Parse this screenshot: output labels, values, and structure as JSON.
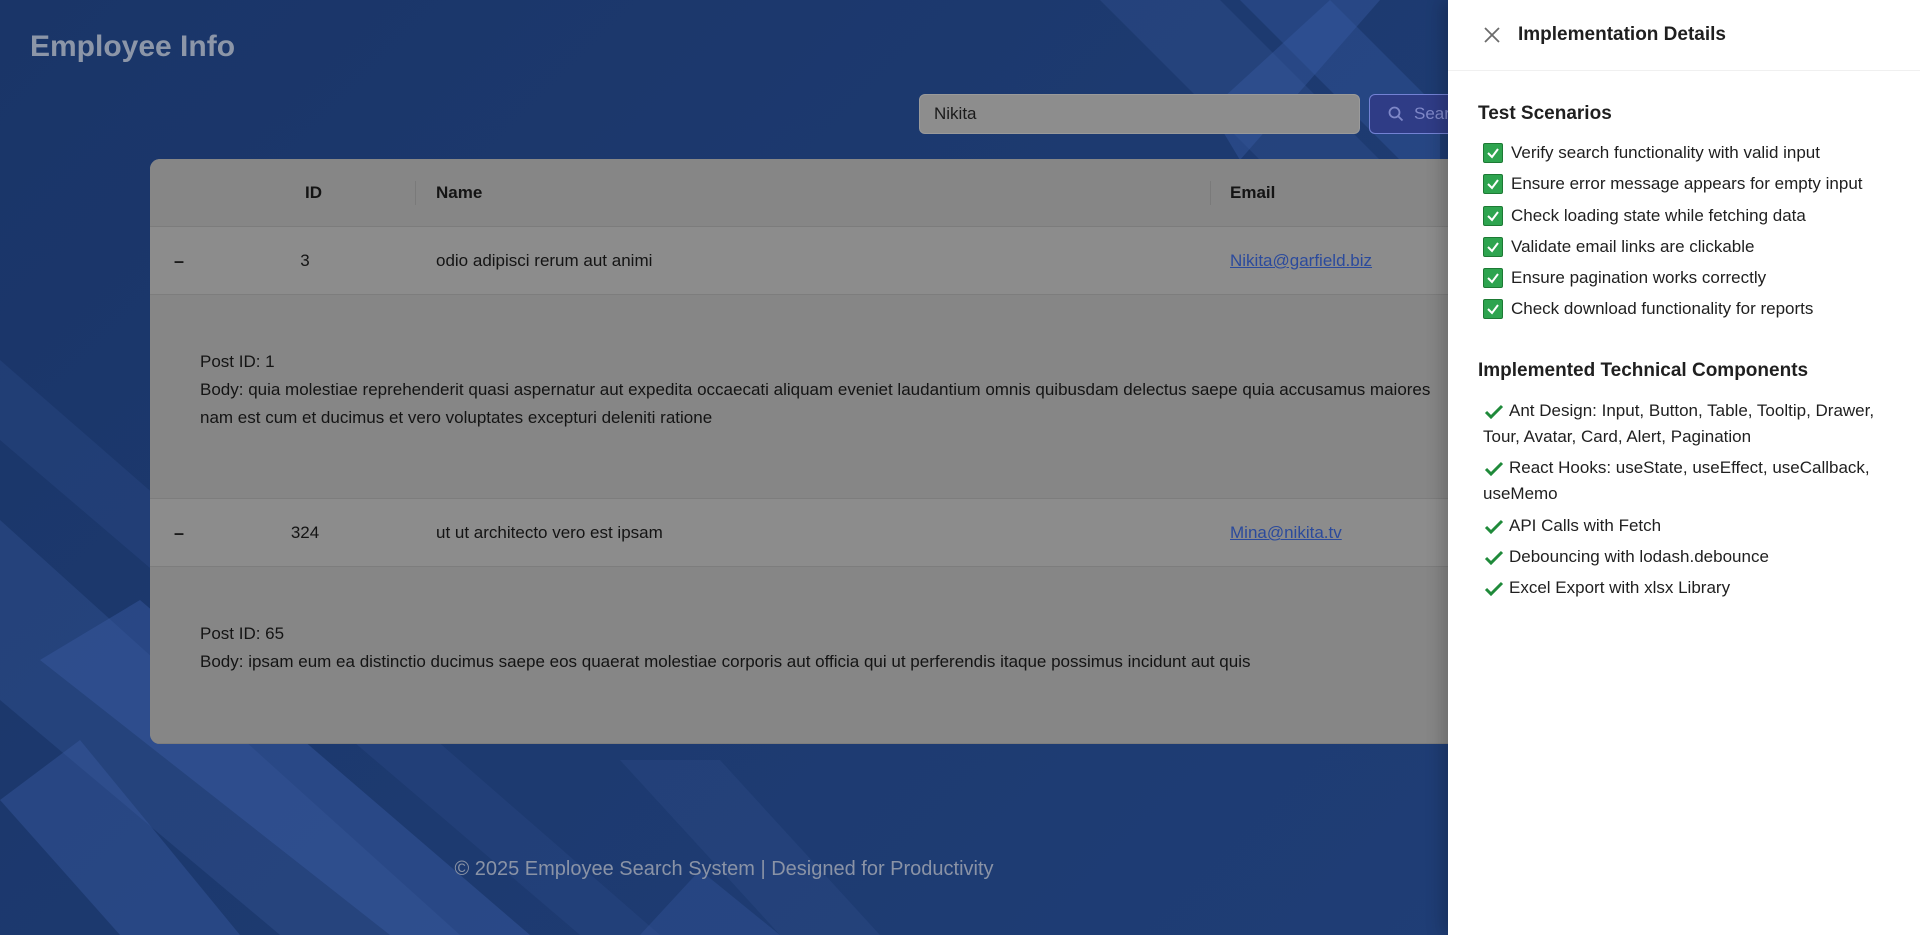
{
  "app": {
    "title": "Employee Info"
  },
  "search": {
    "value": "Nikita",
    "button_label": "Search"
  },
  "table": {
    "columns": {
      "id": "ID",
      "name": "Name",
      "email": "Email"
    },
    "rows": [
      {
        "id": "3",
        "name": "odio adipisci rerum aut animi",
        "email": "Nikita@garfield.biz",
        "post_id": "Post ID: 1",
        "post_body": "Body: quia molestiae reprehenderit quasi aspernatur aut expedita occaecati aliquam eveniet laudantium omnis quibusdam delectus saepe quia accusamus maiores nam est cum et ducimus et vero voluptates excepturi deleniti ratione"
      },
      {
        "id": "324",
        "name": "ut ut architecto vero est ipsam",
        "email": "Mina@nikita.tv",
        "post_id": "Post ID: 65",
        "post_body": "Body: ipsam eum ea distinctio ducimus saepe eos quaerat molestiae corporis aut officia qui ut perferendis itaque possimus incidunt aut quis"
      }
    ]
  },
  "footer": {
    "text": "© 2025 Employee Search System | Designed for Productivity"
  },
  "drawer": {
    "title": "Implementation Details",
    "test_title": "Test Scenarios",
    "tests": [
      "Verify search functionality with valid input",
      "Ensure error message appears for empty input",
      "Check loading state while fetching data",
      "Validate email links are clickable",
      "Ensure pagination works correctly",
      "Check download functionality for reports"
    ],
    "tech_title": "Implemented Technical Components",
    "tech": [
      "Ant Design: Input, Button, Table, Tooltip, Drawer, Tour, Avatar, Card, Alert, Pagination",
      "React Hooks: useState, useEffect, useCallback, useMemo",
      "API Calls with Fetch",
      "Debouncing with lodash.debounce",
      "Excel Export with xlsx Library"
    ]
  },
  "colors": {
    "background": "#1b3566",
    "checkbox_green": "#2ea44f",
    "link_blue": "#2b4a9c"
  },
  "icons": {
    "close": "close-icon",
    "search": "search-icon",
    "check": "checkbox-checked-icon",
    "tick": "check-mark-icon"
  }
}
